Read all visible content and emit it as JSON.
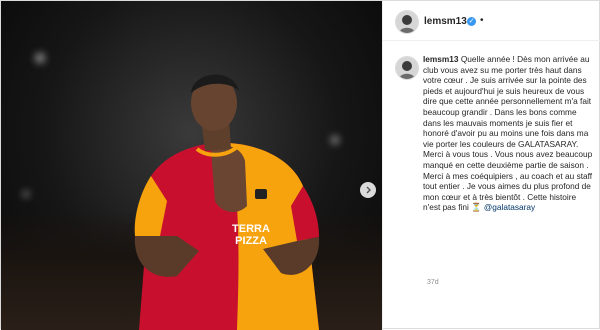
{
  "post": {
    "username": "lemsm13",
    "header_separator": "•",
    "caption_username": "lemsm13",
    "caption_text": "Quelle année ! Dès mon arrivée au club vous avez su me porter très haut dans votre cœur . Je suis arrivée sur la pointe des pieds et aujourd'hui je suis heureux de vous dire que cette année personnellement m'a fait beaucoup grandir . Dans les bons comme dans les mauvais moments je suis fier et honoré d'avoir pu au moins une fois dans ma vie porter les couleurs de GALATASARAY. Merci à vous tous . Vous nous avez beaucoup manqué en cette deuxième partie de saison . Merci à mes coéquipiers , au coach et au staff tout entier . Je vous aimes du plus profond de mon cœur et à très bientôt . Cette histoire n'est pas fini",
    "caption_emoji": "⏳",
    "caption_mention": "@galatasaray",
    "time_ago": "37d",
    "jersey_text_1": "TERRA",
    "jersey_text_2": "PIZZA",
    "icons": {
      "avatar": "profile-avatar",
      "verified": "verified-badge-icon",
      "next": "chevron-right-icon"
    },
    "colors": {
      "jersey_red": "#c8102e",
      "jersey_yellow": "#f7a30d",
      "verified_blue": "#3897f0",
      "mention_blue": "#003569"
    }
  }
}
